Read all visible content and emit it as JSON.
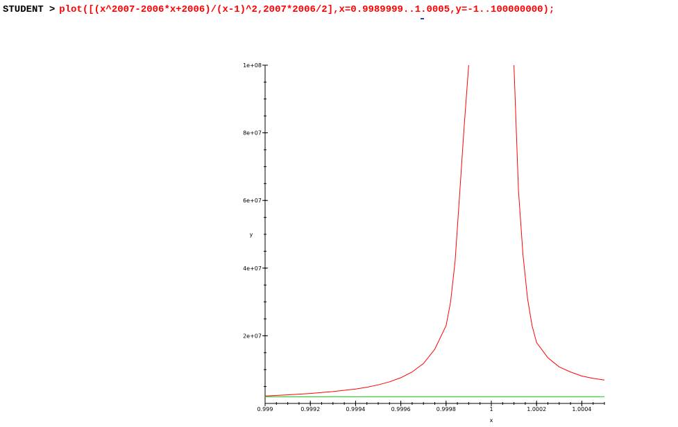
{
  "worksheet": {
    "prompt_label": "STUDENT",
    "prompt_symbol": ">",
    "command": "plot([(x^2007-2006*x+2006)/(x-1)^2,2007*2006/2],x=0.9989999..1.0005,y=-1..100000000);"
  },
  "chart_data": {
    "type": "line",
    "xlabel": "x",
    "ylabel": "y",
    "xlim": [
      0.999,
      1.0005
    ],
    "ylim": [
      0,
      100000000
    ],
    "x_ticks": [
      {
        "value": 0.999,
        "label": "0.999"
      },
      {
        "value": 0.9992,
        "label": "0.9992"
      },
      {
        "value": 0.9994,
        "label": "0.9994"
      },
      {
        "value": 0.9996,
        "label": "0.9996"
      },
      {
        "value": 0.9998,
        "label": "0.9998"
      },
      {
        "value": 1.0,
        "label": "1"
      },
      {
        "value": 1.0002,
        "label": "1.0002"
      },
      {
        "value": 1.0004,
        "label": "1.0004"
      }
    ],
    "y_ticks": [
      {
        "value": 20000000,
        "label": "2e+07"
      },
      {
        "value": 40000000,
        "label": "4e+07"
      },
      {
        "value": 60000000,
        "label": "6e+07"
      },
      {
        "value": 80000000,
        "label": "8e+07"
      },
      {
        "value": 100000000,
        "label": "1e+08"
      }
    ],
    "grid": false,
    "series": [
      {
        "color": "#ff0000",
        "segments": [
          {
            "x": [
              0.999,
              0.9991,
              0.9992,
              0.9993,
              0.9994,
              0.99945,
              0.9995,
              0.99955,
              0.9996,
              0.99965,
              0.9997,
              0.99975,
              0.9998,
              0.99982,
              0.99984,
              0.99986,
              0.99988,
              0.9999
            ],
            "y": [
              2200000,
              2550000,
              2950000,
              3500000,
              4250000,
              4800000,
              5500000,
              6400000,
              7600000,
              9300000,
              11800000,
              16000000,
              23000000,
              30000000,
              42000000,
              62000000,
              82000000,
              100000000
            ]
          },
          {
            "x": [
              1.0001,
              1.00012,
              1.00014,
              1.00016,
              1.00018,
              1.0002,
              1.00025,
              1.0003,
              1.00035,
              1.0004,
              1.00045,
              1.0005
            ],
            "y": [
              100000000,
              63000000,
              44000000,
              31000000,
              23000000,
              18000000,
              13500000,
              10800000,
              9300000,
              8100000,
              7400000,
              6900000
            ]
          }
        ]
      },
      {
        "color": "#00cc00",
        "segments": [
          {
            "x": [
              0.999,
              1.0005
            ],
            "y": [
              2013021,
              2013021
            ]
          }
        ]
      }
    ]
  }
}
